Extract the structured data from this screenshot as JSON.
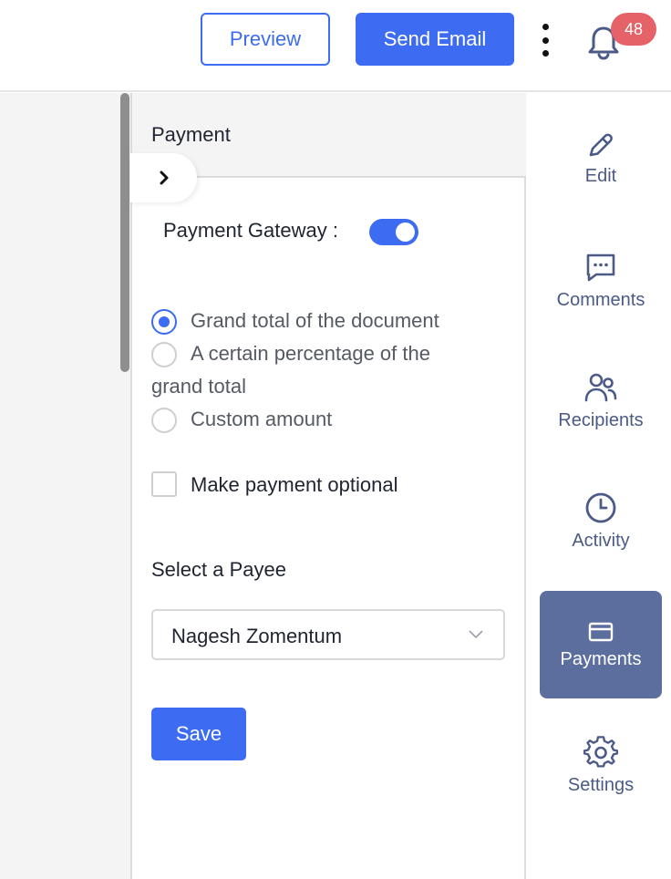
{
  "header": {
    "preview_label": "Preview",
    "send_label": "Send Email",
    "notification_count": "48"
  },
  "panel": {
    "title": "Payment",
    "gateway_label": "Payment Gateway :",
    "gateway_enabled": true,
    "amount_options": [
      {
        "label": "Grand total of the document",
        "selected": true
      },
      {
        "label": "A certain percentage of the",
        "label_line2": "grand total",
        "selected": false
      },
      {
        "label": "Custom amount",
        "selected": false
      }
    ],
    "optional_label": "Make payment optional",
    "optional_checked": false,
    "payee_label": "Select a Payee",
    "payee_value": "Nagesh Zomentum",
    "save_label": "Save"
  },
  "sidebar": {
    "items": [
      {
        "label": "Edit",
        "icon": "pencil-icon"
      },
      {
        "label": "Comments",
        "icon": "comment-icon"
      },
      {
        "label": "Recipients",
        "icon": "users-icon"
      },
      {
        "label": "Activity",
        "icon": "clock-icon"
      },
      {
        "label": "Payments",
        "icon": "card-icon",
        "active": true
      },
      {
        "label": "Settings",
        "icon": "gear-icon"
      }
    ]
  },
  "colors": {
    "accent": "#3d6cf2",
    "badge": "#e56269",
    "sidebar_text": "#4b5a86",
    "sidebar_active_bg": "#5b6e9d"
  }
}
